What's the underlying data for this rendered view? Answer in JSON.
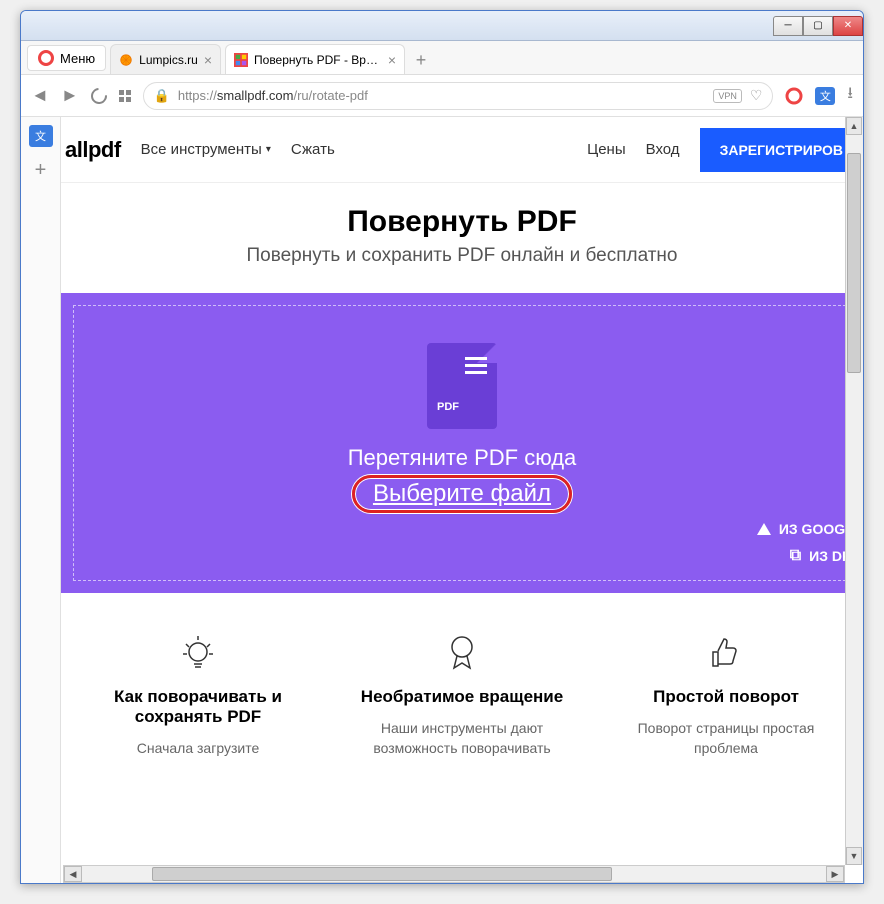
{
  "window": {
    "menu_label": "Меню"
  },
  "tabs": [
    {
      "title": "Lumpics.ru",
      "active": false
    },
    {
      "title": "Повернуть PDF - Вращат",
      "active": true
    }
  ],
  "address": {
    "scheme": "https://",
    "host": "smallpdf.com",
    "path": "/ru/rotate-pdf",
    "vpn": "VPN"
  },
  "site_nav": {
    "logo": "allpdf",
    "all_tools": "Все инструменты",
    "compress": "Сжать",
    "pricing": "Цены",
    "login": "Вход",
    "signup": "ЗАРЕГИСТРИРОВ"
  },
  "hero": {
    "title": "Повернуть PDF",
    "subtitle": "Повернуть и сохранить PDF онлайн и бесплатно"
  },
  "dropzone": {
    "drag_text": "Перетяните PDF сюда",
    "choose_file": "Выберите файл",
    "pdf_badge": "PDF",
    "from_google": "ИЗ GOOGLE",
    "from_dropbox": "ИЗ DRO"
  },
  "features": [
    {
      "icon": "bulb",
      "title": "Как поворачивать и сохранять PDF",
      "text": "Сначала загрузите"
    },
    {
      "icon": "badge",
      "title": "Необратимое вращение",
      "text": "Наши инструменты дают возможность поворачивать"
    },
    {
      "icon": "thumbs",
      "title": "Простой поворот",
      "text": "Поворот страницы простая проблема"
    }
  ]
}
